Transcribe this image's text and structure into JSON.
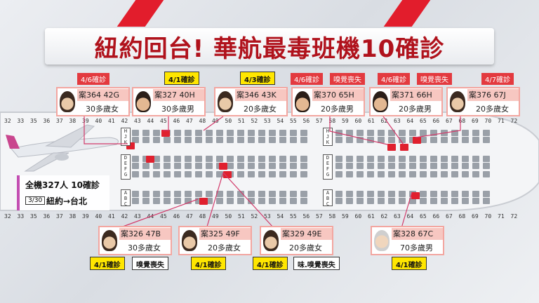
{
  "title": "紐約回台! 華航最毒班機10確診",
  "summary": {
    "total": "全機327人 10確診",
    "date": "3/30",
    "route": "紐約→台北"
  },
  "rows": [
    "32",
    "33",
    "35",
    "36",
    "37",
    "38",
    "39",
    "40",
    "41",
    "42",
    "43",
    "44",
    "45",
    "46",
    "47",
    "48",
    "49",
    "50",
    "51",
    "52",
    "53",
    "54",
    "55",
    "56",
    "57",
    "58",
    "59",
    "60",
    "61",
    "62",
    "63",
    "64",
    "65",
    "66",
    "67",
    "68",
    "69",
    "70",
    "71",
    "72"
  ],
  "zones": {
    "left_top": "HJK",
    "left_mid": "DEFG",
    "left_bot": "ABC",
    "right_top": "HJK",
    "right_mid": "DEFG",
    "right_bot": "ABC"
  },
  "cases": [
    {
      "id": "案364 42G",
      "demo": "30多歲女",
      "confirmed": "4/6確診",
      "symptom": "",
      "face": "f"
    },
    {
      "id": "案327 40H",
      "demo": "30多歲男",
      "confirmed": "4/1確診",
      "symptom": "",
      "face": "m"
    },
    {
      "id": "案346 43K",
      "demo": "20多歲女",
      "confirmed": "4/3確診",
      "symptom": "",
      "face": "f"
    },
    {
      "id": "案370 65H",
      "demo": "20多歲男",
      "confirmed": "4/6確診",
      "symptom": "嗅覺喪失",
      "face": "m"
    },
    {
      "id": "案371 66H",
      "demo": "20多歲男",
      "confirmed": "4/6確診",
      "symptom": "嗅覺喪失",
      "face": "m"
    },
    {
      "id": "案376 67J",
      "demo": "20多歲女",
      "confirmed": "4/7確診",
      "symptom": "",
      "face": "f"
    },
    {
      "id": "案326 47B",
      "demo": "30多歲女",
      "confirmed": "4/1確診",
      "symptom": "嗅覺喪失",
      "face": "f"
    },
    {
      "id": "案325 49F",
      "demo": "20多歲女",
      "confirmed": "4/1確診",
      "symptom": "",
      "face": "f"
    },
    {
      "id": "案329 49E",
      "demo": "20多歲女",
      "confirmed": "4/1確診",
      "symptom": "味.嗅覺喪失",
      "face": "f"
    },
    {
      "id": "案328 67C",
      "demo": "70多歲男",
      "confirmed": "4/1確診",
      "symptom": "",
      "face": "o"
    }
  ],
  "colors": {
    "accent": "#e21d2c",
    "title": "#b0121c",
    "tag_red": "#e33a3f",
    "tag_yellow": "#ffe600",
    "seat": "#9aa0a8",
    "seat_case": "#e0202e"
  }
}
